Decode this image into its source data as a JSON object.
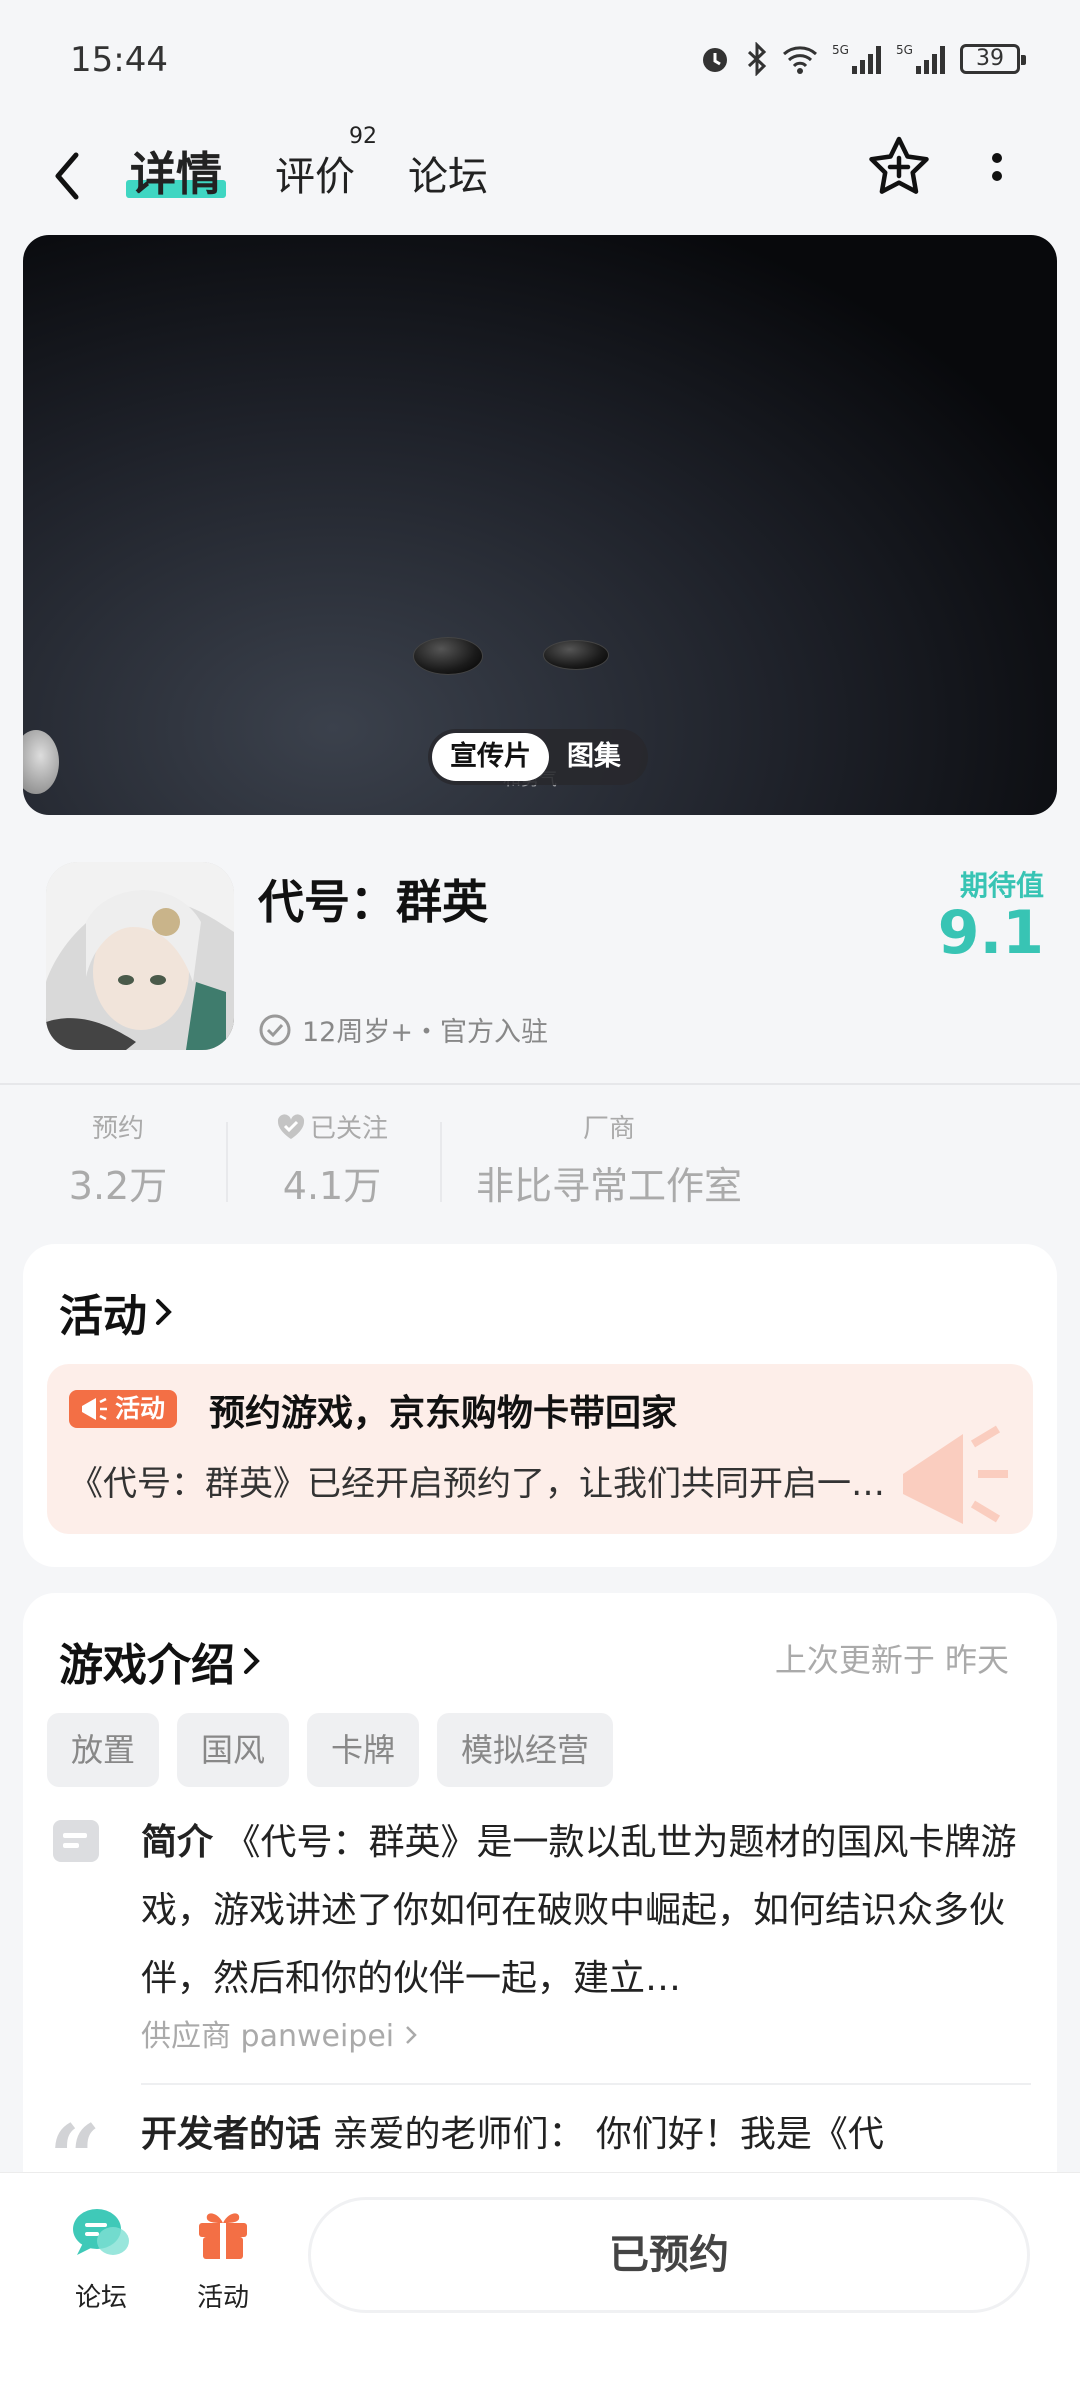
{
  "status_bar": {
    "time": "15:44",
    "battery": "39"
  },
  "nav": {
    "tabs": [
      {
        "label": "详情"
      },
      {
        "label": "评价",
        "badge": "92"
      },
      {
        "label": "论坛"
      }
    ]
  },
  "hero": {
    "toggle": [
      "宣传片",
      "图集"
    ],
    "caption": "和勇气"
  },
  "game": {
    "title": "代号：群英",
    "meta": "12周岁+・官方入驻",
    "score_label": "期待值",
    "score_value": "9.1"
  },
  "stats": [
    {
      "label": "预约",
      "value": "3.2万"
    },
    {
      "label": "已关注",
      "value": "4.1万"
    },
    {
      "label": "厂商",
      "value": "非比寻常工作室"
    }
  ],
  "activity": {
    "title": "活动",
    "badge": "活动",
    "headline": "预约游戏，京东购物卡带回家",
    "desc": "《代号：群英》已经开启预约了，让我们共同开启一…"
  },
  "intro": {
    "title": "游戏介绍",
    "update_note": "上次更新于 昨天",
    "tags": [
      "放置",
      "国风",
      "卡牌",
      "模拟经营"
    ],
    "summary_label": "简介",
    "summary": "《代号：群英》是一款以乱世为题材的国风卡牌游戏，游戏讲述了你如何在破败中崛起，如何结识众多伙伴，然后和你的伙伴一起，建立…",
    "supplier": "供应商 panweipei",
    "dev_label": "开发者的话",
    "dev_text": "亲爱的老师们：  你们好！我是《代"
  },
  "bottom_bar": {
    "forum_label": "论坛",
    "activity_label": "活动",
    "reserve_label": "已预约"
  },
  "colors": {
    "accent": "#38c4b4",
    "activity_orange": "#f36f45",
    "activity_bg": "#fdeee9"
  }
}
